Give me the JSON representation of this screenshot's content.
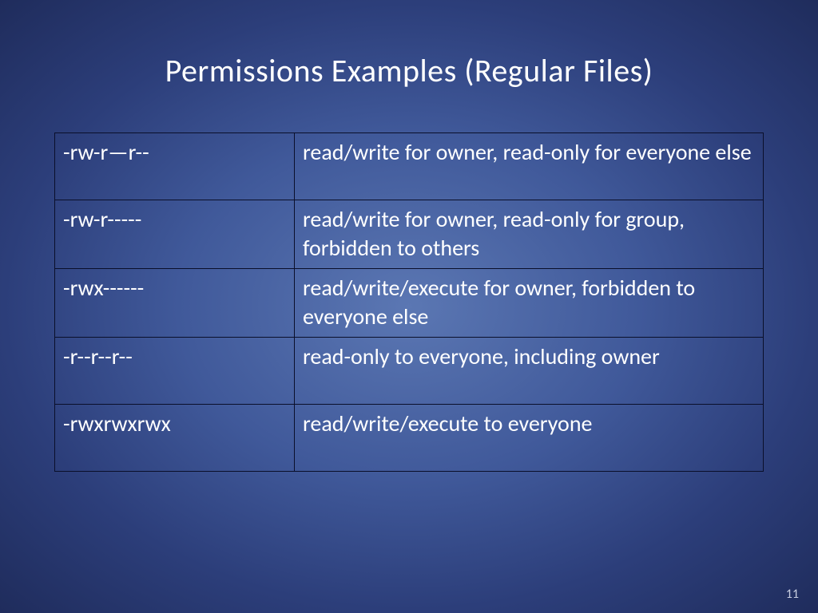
{
  "title": "Permissions Examples (Regular Files)",
  "rows": [
    {
      "perm": "-rw-r—r--",
      "desc": "read/write for owner, read-only for everyone else"
    },
    {
      "perm": "-rw-r-----",
      "desc": "read/write for owner, read-only for group, forbidden to others"
    },
    {
      "perm": "-rwx------",
      "desc": "read/write/execute for owner, forbidden to everyone else"
    },
    {
      "perm": "-r--r--r--",
      "desc": "read-only to everyone, including owner"
    },
    {
      "perm": "-rwxrwxrwx",
      "desc": "read/write/execute to everyone"
    }
  ],
  "page_number": "11"
}
